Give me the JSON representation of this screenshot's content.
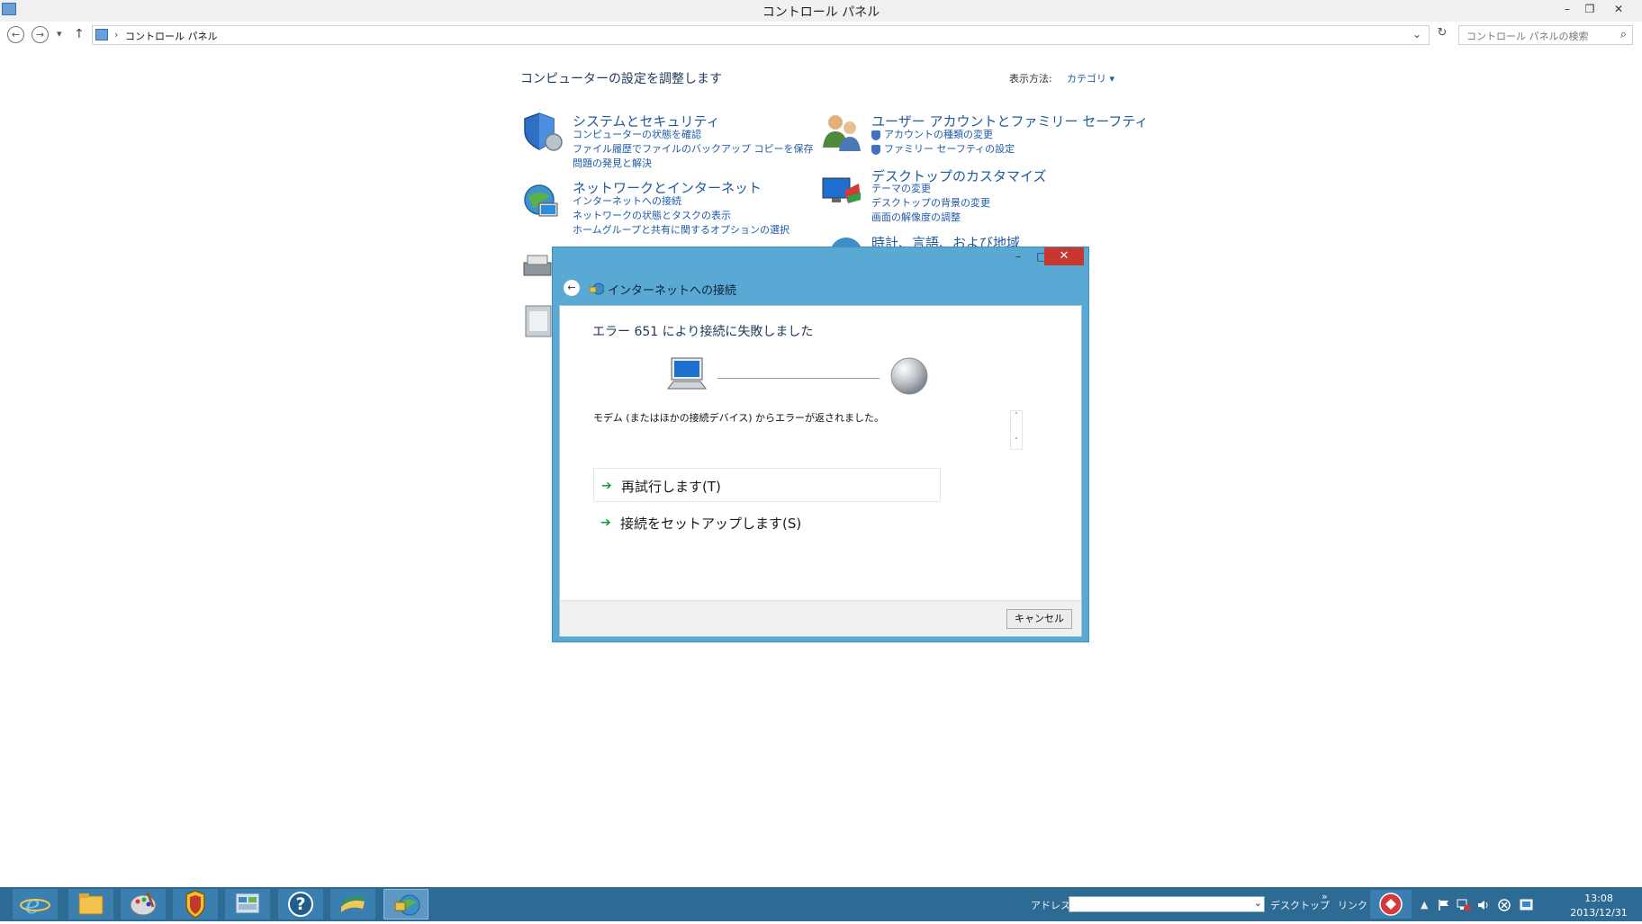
{
  "window": {
    "title": "コントロール パネル",
    "minimize": "–",
    "restore": "❐",
    "close": "✕"
  },
  "nav": {
    "back": "←",
    "forward": "→",
    "dropdown": "▾",
    "up": "↑",
    "breadcrumb_sep": "›",
    "breadcrumb": "コントロール パネル",
    "address_dropdown": "⌄",
    "refresh": "↻",
    "search_placeholder": "コントロール パネルの検索",
    "search_icon": "⌕"
  },
  "control_panel": {
    "heading": "コンピューターの設定を調整します",
    "view_label": "表示方法:",
    "view_value": "カテゴリ ▾",
    "categories": [
      {
        "title": "システムとセキュリティ",
        "links": [
          "コンピューターの状態を確認",
          "ファイル履歴でファイルのバックアップ コピーを保存",
          "問題の発見と解決"
        ]
      },
      {
        "title": "ネットワークとインターネット",
        "links": [
          "インターネットへの接続",
          "ネットワークの状態とタスクの表示",
          "ホームグループと共有に関するオプションの選択"
        ]
      },
      {
        "title": "ユーザー アカウントとファミリー セーフティ",
        "links": [
          "アカウントの種類の変更",
          "ファミリー セーフティの設定"
        ]
      },
      {
        "title": "デスクトップのカスタマイズ",
        "links": [
          "テーマの変更",
          "デスクトップの背景の変更",
          "画面の解像度の調整"
        ]
      },
      {
        "title": "時計、言語、および地域",
        "links": []
      }
    ]
  },
  "dialog": {
    "title": "インターネットへの接続",
    "back": "←",
    "minimize": "–",
    "maximize": "□",
    "close": "✕",
    "error_heading": "エラー 651 により接続に失敗しました",
    "error_message": "モデム (またはほかの接続デバイス) からエラーが返されました。",
    "scroll_up": "˄",
    "scroll_down": "˅",
    "commands": [
      {
        "arrow": "➔",
        "label": "再試行します(T)"
      },
      {
        "arrow": "➔",
        "label": "接続をセットアップします(S)"
      }
    ],
    "cancel": "キャンセル"
  },
  "taskbar": {
    "address_label": "アドレス",
    "address_dropdown": "⌄",
    "refresh": "↻",
    "desktop": "デスクトップ",
    "more": "»",
    "links": "リンク",
    "tray_arrow": "▲",
    "time": "13:08",
    "date": "2013/12/31",
    "help_glyph": "?"
  },
  "colors": {
    "dialog_frame": "#5aa8d4",
    "taskbar": "#2d6a94",
    "close_red": "#c7372f",
    "link_blue": "#1e5aa8"
  }
}
